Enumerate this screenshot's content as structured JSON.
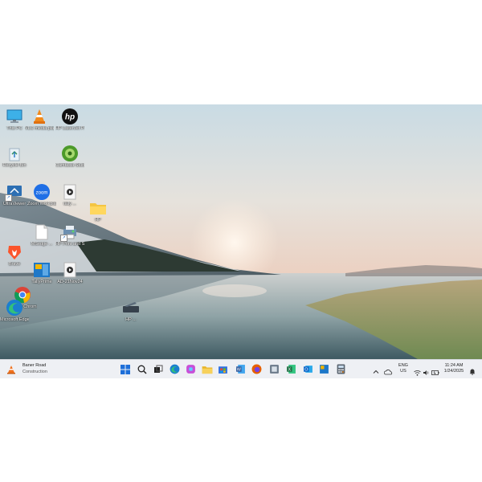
{
  "desktop": {
    "icons": [
      {
        "label": "This PC",
        "icon": "monitor-icon"
      },
      {
        "label": "VLC media player",
        "icon": "vlc-cone-icon"
      },
      {
        "label": "HP LaserJet Pro MFP ...",
        "icon": "hp-logo-icon"
      },
      {
        "label": "Recycle Bin",
        "icon": "recycle-bin-icon"
      },
      {
        "label": "Camtasia Studio 8",
        "icon": "camtasia-icon"
      },
      {
        "label": "UltraViewer",
        "icon": "ultraviewer-icon"
      },
      {
        "label": "Zoom Workplace",
        "icon": "zoom-icon"
      },
      {
        "label": "tally ...",
        "icon": "video-file-icon"
      },
      {
        "label": "HP",
        "icon": "folder-icon"
      },
      {
        "label": "Brave",
        "icon": "brave-lion-icon"
      },
      {
        "label": "MSedge ...",
        "icon": "document-icon"
      },
      {
        "label": "HP Print and Scan Doctor",
        "icon": "hp-print-doctor-icon"
      },
      {
        "label": "TallyPrime",
        "icon": "tallyprime-icon"
      },
      {
        "label": "AD-21Nov24",
        "icon": "video-file-icon"
      },
      {
        "label": "Google Chrome",
        "icon": "chrome-icon"
      },
      {
        "label": "Microsoft Edge",
        "icon": "edge-icon"
      },
      {
        "label": "HP ...",
        "icon": "scanner-icon"
      }
    ]
  },
  "taskbar": {
    "weather": {
      "title": "Baner Road",
      "subtitle": "Construction",
      "icon": "traffic-cone-icon"
    },
    "pinned": [
      {
        "name": "start-button",
        "icon": "windows-logo-icon",
        "color": "#1e6fd9"
      },
      {
        "name": "search-button",
        "icon": "search-icon",
        "color": "#333333"
      },
      {
        "name": "task-view-button",
        "icon": "task-view-icon",
        "color": "#333333"
      },
      {
        "name": "app-camera",
        "icon": "camera-icon",
        "color": "#444444"
      },
      {
        "name": "app-edge",
        "icon": "edge-icon",
        "color": "#1a9a8a"
      },
      {
        "name": "app-copilot",
        "icon": "copilot-icon",
        "color": "#c84fd8"
      },
      {
        "name": "app-file-explorer",
        "icon": "folder-icon",
        "color": "#f2c94c"
      },
      {
        "name": "app-store",
        "icon": "store-icon",
        "color": "#2f6fe0"
      },
      {
        "name": "app-word",
        "icon": "word-icon",
        "color": "#2b579a"
      },
      {
        "name": "app-firefox",
        "icon": "firefox-icon",
        "color": "#e66000"
      },
      {
        "name": "app-scanner",
        "icon": "scanner-icon",
        "color": "#6b7a8a"
      },
      {
        "name": "app-excel",
        "icon": "excel-icon",
        "color": "#1e7145"
      },
      {
        "name": "app-outlook",
        "icon": "outlook-icon",
        "color": "#0a64c8"
      },
      {
        "name": "app-tally",
        "icon": "tallyprime-icon",
        "color": "#f0b400"
      },
      {
        "name": "app-calculator",
        "icon": "calculator-icon",
        "color": "#5a6470"
      }
    ],
    "tray": {
      "lang": "ENG",
      "region": "US",
      "time": "11:24 AM",
      "date": "1/24/2025"
    }
  }
}
